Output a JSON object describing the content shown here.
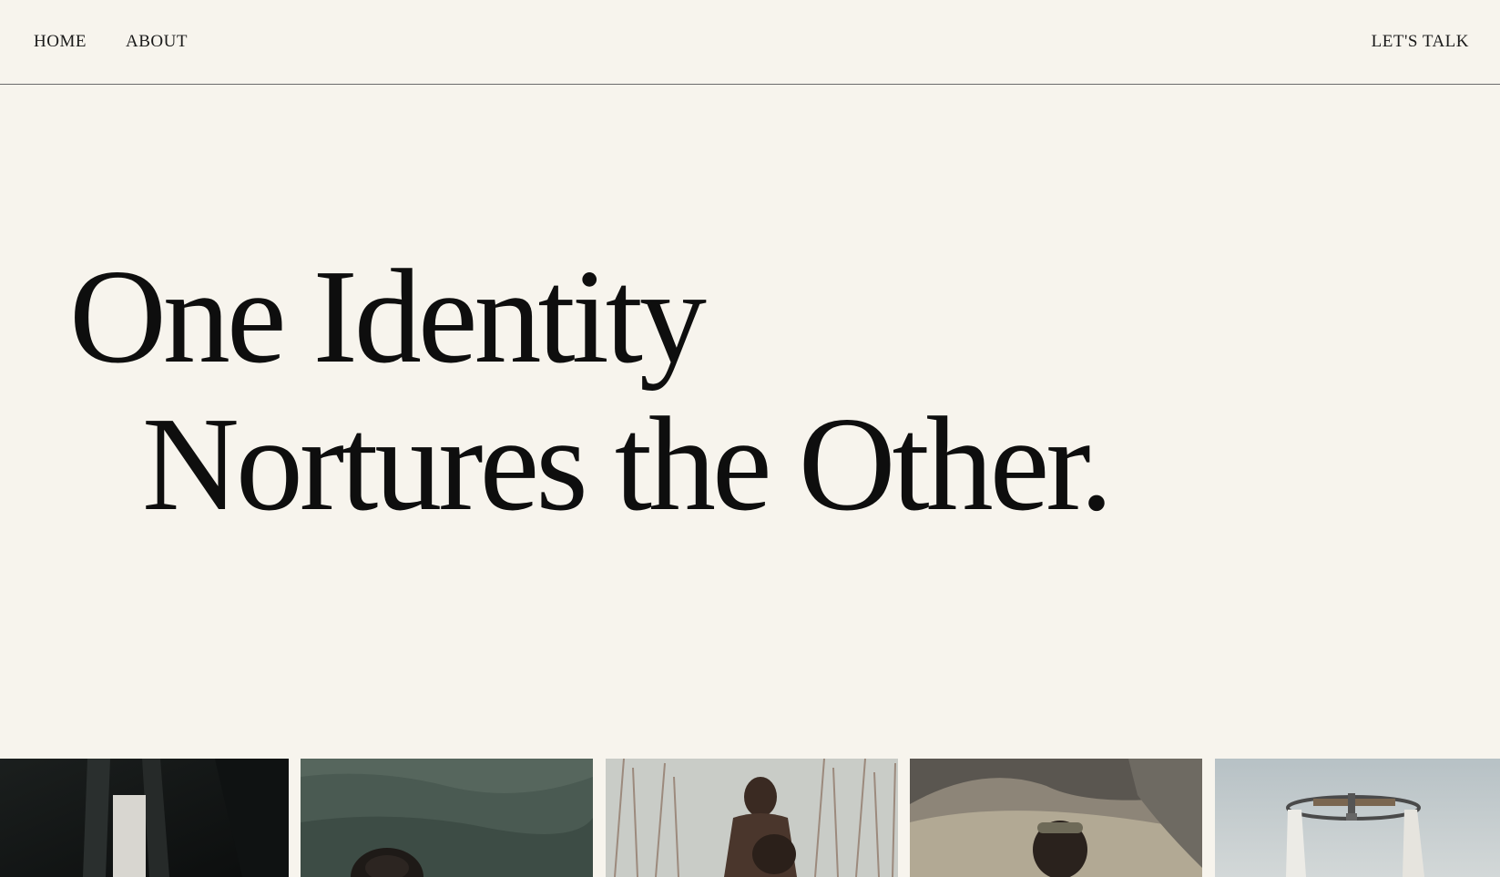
{
  "nav": {
    "home": "HOME",
    "about": "ABOUT",
    "cta": "LET'S TALK"
  },
  "hero": {
    "line1": "One Identity",
    "line2": "Nortures the Other."
  },
  "gallery": {
    "images": [
      {
        "name": "dark-figure-photo"
      },
      {
        "name": "man-in-water-photo"
      },
      {
        "name": "children-in-reeds-photo"
      },
      {
        "name": "man-on-hillside-photo"
      },
      {
        "name": "outdoor-shower-structure-photo"
      }
    ]
  },
  "colors": {
    "background": "#f7f4ed",
    "text": "#111111",
    "divider": "#6b6b6b"
  }
}
